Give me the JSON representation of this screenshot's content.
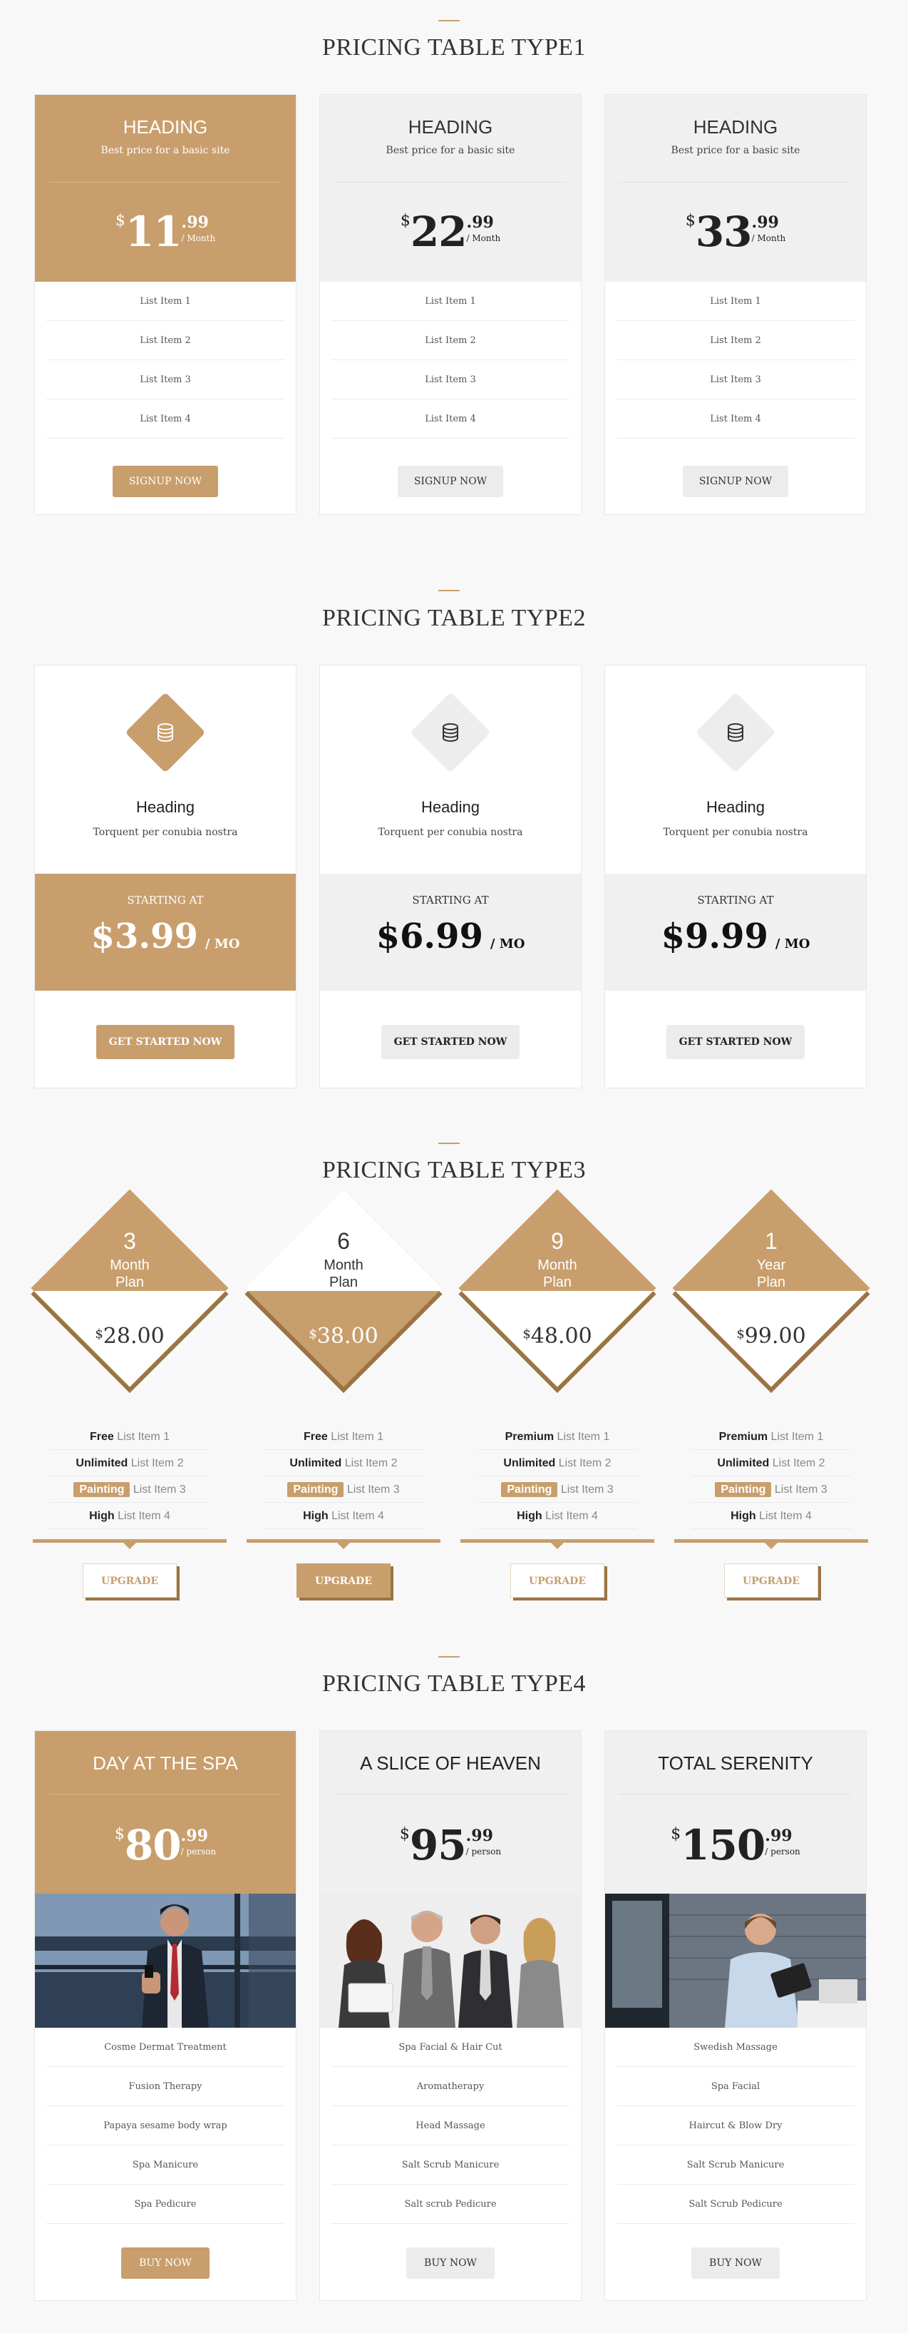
{
  "colors": {
    "accent": "#c89e6c",
    "accent_dark": "#9b7444",
    "panel": "#f0f0f0",
    "background": "#f8f8f8"
  },
  "type1": {
    "title": "PRICING TABLE TYPE1",
    "cards": [
      {
        "heading": "HEADING",
        "subtitle": "Best price for a basic site",
        "currency": "$",
        "amount": "11",
        "cents": ".99",
        "period": "/ Month",
        "items": [
          "List Item 1",
          "List Item 2",
          "List Item 3",
          "List Item 4"
        ],
        "button": "SIGNUP NOW"
      },
      {
        "heading": "HEADING",
        "subtitle": "Best price for a basic site",
        "currency": "$",
        "amount": "22",
        "cents": ".99",
        "period": "/ Month",
        "items": [
          "List Item 1",
          "List Item 2",
          "List Item 3",
          "List Item 4"
        ],
        "button": "SIGNUP NOW"
      },
      {
        "heading": "HEADING",
        "subtitle": "Best price for a basic site",
        "currency": "$",
        "amount": "33",
        "cents": ".99",
        "period": "/ Month",
        "items": [
          "List Item 1",
          "List Item 2",
          "List Item 3",
          "List Item 4"
        ],
        "button": "SIGNUP NOW"
      }
    ]
  },
  "type2": {
    "title": "PRICING TABLE TYPE2",
    "cards": [
      {
        "icon": "database-icon",
        "heading": "Heading",
        "subtitle": "Torquent per conubia nostra",
        "starting": "STARTING AT",
        "price": "$3.99",
        "period": "/ MO",
        "button": "GET STARTED NOW"
      },
      {
        "icon": "database-icon",
        "heading": "Heading",
        "subtitle": "Torquent per conubia nostra",
        "starting": "STARTING AT",
        "price": "$6.99",
        "period": "/ MO",
        "button": "GET STARTED NOW"
      },
      {
        "icon": "database-icon",
        "heading": "Heading",
        "subtitle": "Torquent per conubia nostra",
        "starting": "STARTING AT",
        "price": "$9.99",
        "period": "/ MO",
        "button": "GET STARTED NOW"
      }
    ]
  },
  "type3": {
    "title": "PRICING TABLE TYPE3",
    "cards": [
      {
        "num": "3",
        "unit": "Month",
        "plan": "Plan",
        "currency": "$",
        "price": "28.00",
        "items": [
          {
            "bold": "Free",
            "text": "List Item 1"
          },
          {
            "bold": "Unlimited",
            "text": "List Item 2"
          },
          {
            "tag": "Painting",
            "text": "List Item 3"
          },
          {
            "bold": "High",
            "text": "List Item 4"
          }
        ],
        "button": "UPGRADE"
      },
      {
        "num": "6",
        "unit": "Month",
        "plan": "Plan",
        "currency": "$",
        "price": "38.00",
        "items": [
          {
            "bold": "Free",
            "text": "List Item 1"
          },
          {
            "bold": "Unlimited",
            "text": "List Item 2"
          },
          {
            "tag": "Painting",
            "text": "List Item 3"
          },
          {
            "bold": "High",
            "text": "List Item 4"
          }
        ],
        "button": "UPGRADE"
      },
      {
        "num": "9",
        "unit": "Month",
        "plan": "Plan",
        "currency": "$",
        "price": "48.00",
        "items": [
          {
            "bold": "Premium",
            "text": "List Item 1"
          },
          {
            "bold": "Unlimited",
            "text": "List Item 2"
          },
          {
            "tag": "Painting",
            "text": "List Item 3"
          },
          {
            "bold": "High",
            "text": "List Item 4"
          }
        ],
        "button": "UPGRADE"
      },
      {
        "num": "1",
        "unit": "Year",
        "plan": "Plan",
        "currency": "$",
        "price": "99.00",
        "items": [
          {
            "bold": "Premium",
            "text": "List Item 1"
          },
          {
            "bold": "Unlimited",
            "text": "List Item 2"
          },
          {
            "tag": "Painting",
            "text": "List Item 3"
          },
          {
            "bold": "High",
            "text": "List Item 4"
          }
        ],
        "button": "UPGRADE"
      }
    ]
  },
  "type4": {
    "title": "PRICING TABLE TYPE4",
    "cards": [
      {
        "heading": "DAY AT THE SPA",
        "currency": "$",
        "amount": "80",
        "cents": ".99",
        "period": "/ person",
        "items": [
          "Cosme Dermat Treatment",
          "Fusion Therapy",
          "Papaya sesame body wrap",
          "Spa Manicure",
          "Spa Pedicure"
        ],
        "button": "BUY NOW"
      },
      {
        "heading": "A SLICE OF HEAVEN",
        "currency": "$",
        "amount": "95",
        "cents": ".99",
        "period": "/ person",
        "items": [
          "Spa Facial & Hair Cut",
          "Aromatherapy",
          "Head Massage",
          "Salt Scrub Manicure",
          "Salt scrub Pedicure"
        ],
        "button": "BUY NOW"
      },
      {
        "heading": "TOTAL SERENITY",
        "currency": "$",
        "amount": "150",
        "cents": ".99",
        "period": "/ person",
        "items": [
          "Swedish Massage",
          "Spa Facial",
          "Haircut & Blow Dry",
          "Salt Scrub Manicure",
          "Salt Scrub Pedicure"
        ],
        "button": "BUY NOW"
      }
    ]
  }
}
